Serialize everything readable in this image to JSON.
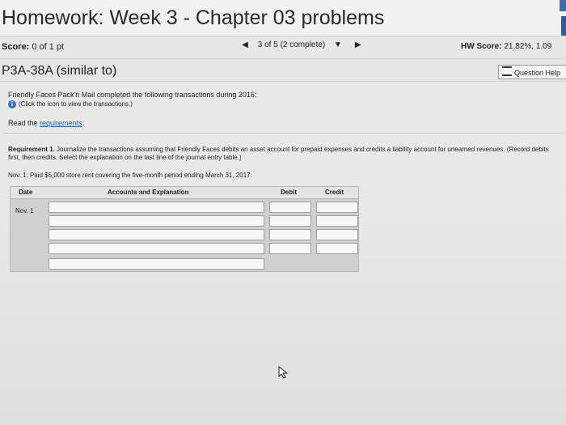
{
  "header": {
    "title": "Homework: Week 3 - Chapter 03 problems"
  },
  "score_bar": {
    "score_label": "Score:",
    "score_value": "0 of 1 pt",
    "prev_icon": "triangle-left",
    "position": "3 of 5 (2 complete)",
    "dropdown_icon": "triangle-down",
    "next_icon": "triangle-right",
    "hw_label": "HW Score:",
    "hw_value": "21.82%, 1.09"
  },
  "problem": {
    "id": "P3A-38A (similar to)",
    "help_label": "Question Help"
  },
  "content": {
    "intro": "Friendly Faces Pack'n Mail completed the following transactions during 2016:",
    "click_note": "(Click the icon to view the transactions.)",
    "read_prefix": "Read the ",
    "read_link": "requirements",
    "read_suffix": ".",
    "requirement_bold": "Requirement 1.",
    "requirement_text": " Journalize the transactions assuming that Friendly Faces debits an asset account for prepaid expenses and credits a liability account for unearned revenues. (Record debits first, then credits. Select the explanation on the last line of the journal entry table.)",
    "transaction": "Nov. 1: Paid $5,000 store rent covering the five-month period ending March 31, 2017."
  },
  "journal": {
    "headers": {
      "date": "Date",
      "accounts": "Accounts and Explanation",
      "debit": "Debit",
      "credit": "Credit"
    },
    "date_value": "Nov. 1"
  }
}
